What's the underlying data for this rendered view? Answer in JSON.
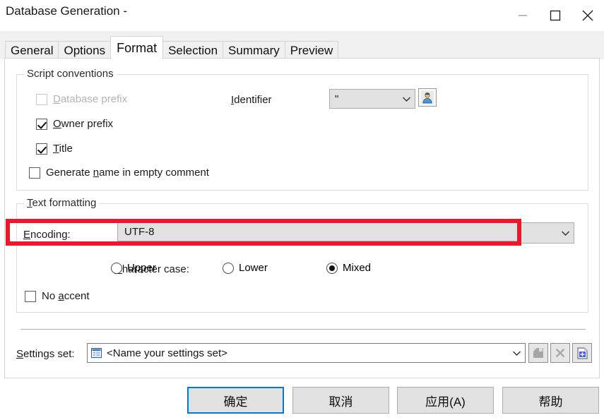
{
  "window": {
    "title": "Database Generation -",
    "controls": [
      {
        "name": "minimize",
        "glyph": "minimize-icon"
      },
      {
        "name": "maximize",
        "glyph": "maximize-icon"
      },
      {
        "name": "close",
        "glyph": "close-icon"
      }
    ]
  },
  "tabs": [
    {
      "label": "General",
      "active": false
    },
    {
      "label": "Options",
      "active": false
    },
    {
      "label": "Format",
      "active": true
    },
    {
      "label": "Selection",
      "active": false
    },
    {
      "label": "Summary",
      "active": false
    },
    {
      "label": "Preview",
      "active": false
    }
  ],
  "script_conventions": {
    "title": "Script conventions",
    "checkboxes": [
      {
        "label": "Database prefix",
        "mnemonic": "D",
        "checked": false,
        "disabled": true
      },
      {
        "label": "Owner prefix",
        "mnemonic": "O",
        "checked": true,
        "disabled": false
      },
      {
        "label": "Title",
        "mnemonic": "T",
        "checked": true,
        "disabled": false
      },
      {
        "label": "Generate name in empty comment",
        "mnemonic": "n",
        "checked": false,
        "disabled": false
      }
    ],
    "identifier": {
      "label": "Identifier",
      "mnemonic": "I",
      "value": "\"",
      "button_icon": "user-icon"
    }
  },
  "text_formatting": {
    "title": "Text formatting",
    "title_mnemonic": "T",
    "encoding": {
      "label": "Encoding:",
      "mnemonic": "E",
      "value": "UTF-8"
    },
    "character_case": {
      "label": "Character case:",
      "mnemonic": "C",
      "options": [
        {
          "label": "Upper",
          "selected": false
        },
        {
          "label": "Lower",
          "selected": false
        },
        {
          "label": "Mixed",
          "selected": true
        }
      ]
    },
    "no_accent": {
      "label": "No accent",
      "mnemonic": "a",
      "checked": false
    }
  },
  "settings_set": {
    "label": "Settings set:",
    "mnemonic": "S",
    "value": "<Name your settings set>",
    "value_icon": "settings-list-icon",
    "buttons": [
      {
        "name": "save-settings-set",
        "icon": "save-icon",
        "disabled": true
      },
      {
        "name": "delete-settings-set",
        "icon": "delete-x-icon",
        "disabled": true
      },
      {
        "name": "new-settings-set",
        "icon": "new-document-icon",
        "disabled": false
      }
    ]
  },
  "dialog_buttons": [
    {
      "label": "确定",
      "name": "ok-button",
      "focused": true
    },
    {
      "label": "取消",
      "name": "cancel-button",
      "focused": false
    },
    {
      "label": "应用(A)",
      "name": "apply-button",
      "focused": false
    },
    {
      "label": "帮助",
      "name": "help-button",
      "focused": false
    }
  ],
  "annotation": {
    "highlight_color": "#e8192c",
    "target": "Encoding field"
  }
}
